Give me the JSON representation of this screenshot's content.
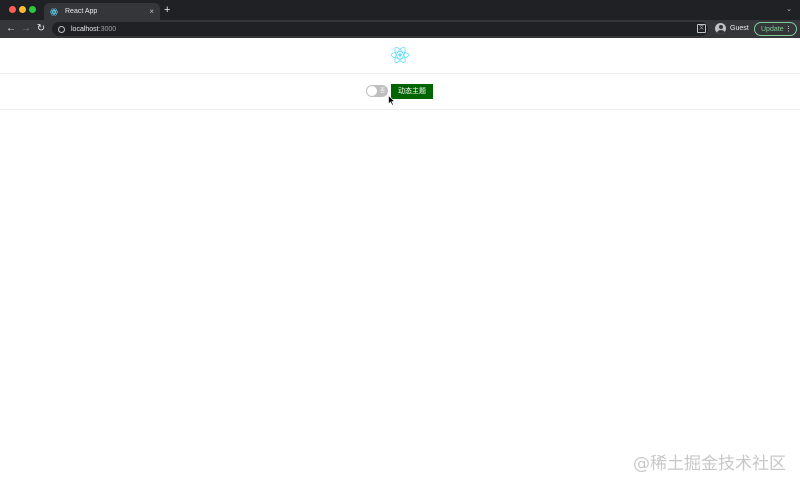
{
  "browser": {
    "tab": {
      "title": "React App",
      "close_glyph": "×"
    },
    "new_tab_glyph": "+",
    "tab_menu_glyph": "⌄",
    "nav": {
      "back": "←",
      "forward": "→",
      "reload": "↻"
    },
    "address": {
      "host": "localhost",
      "port": ":3000"
    },
    "translate_glyph": "文",
    "profile": {
      "name": "Guest"
    },
    "update": {
      "label": "Update",
      "menu_glyph": "⋮"
    }
  },
  "page": {
    "logo_icon": "react-logo-icon",
    "logo_color": "#61dafb",
    "switch": {
      "checked": false,
      "off_text": "否"
    },
    "theme_button": {
      "label": "动态主题",
      "color": "#006400"
    }
  },
  "watermark": "@稀土掘金技术社区"
}
